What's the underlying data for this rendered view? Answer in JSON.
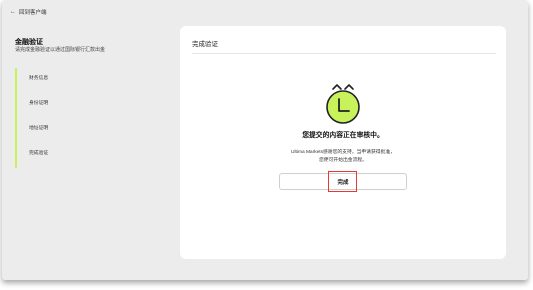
{
  "nav": {
    "back_label": "回到客户端"
  },
  "header": {
    "title": "金融验证",
    "subtitle": "请完成金融验证以通过国际银行汇款出金"
  },
  "steps": [
    {
      "label": "财务信息"
    },
    {
      "label": "身份证明"
    },
    {
      "label": "地址证明"
    },
    {
      "label": "完成验证"
    }
  ],
  "card": {
    "title": "完成验证",
    "status_title": "您提交的内容正在审核中。",
    "status_line1": "Ultima Markets感谢您的支持，当申请获得批准，",
    "status_line2": "您便可开始出金流程。",
    "done_label": "完成"
  },
  "colors": {
    "accent": "#c8f25c",
    "highlight": "#e53935"
  },
  "icons": {
    "status": "alarm-clock-icon",
    "back": "left-arrow-icon"
  }
}
